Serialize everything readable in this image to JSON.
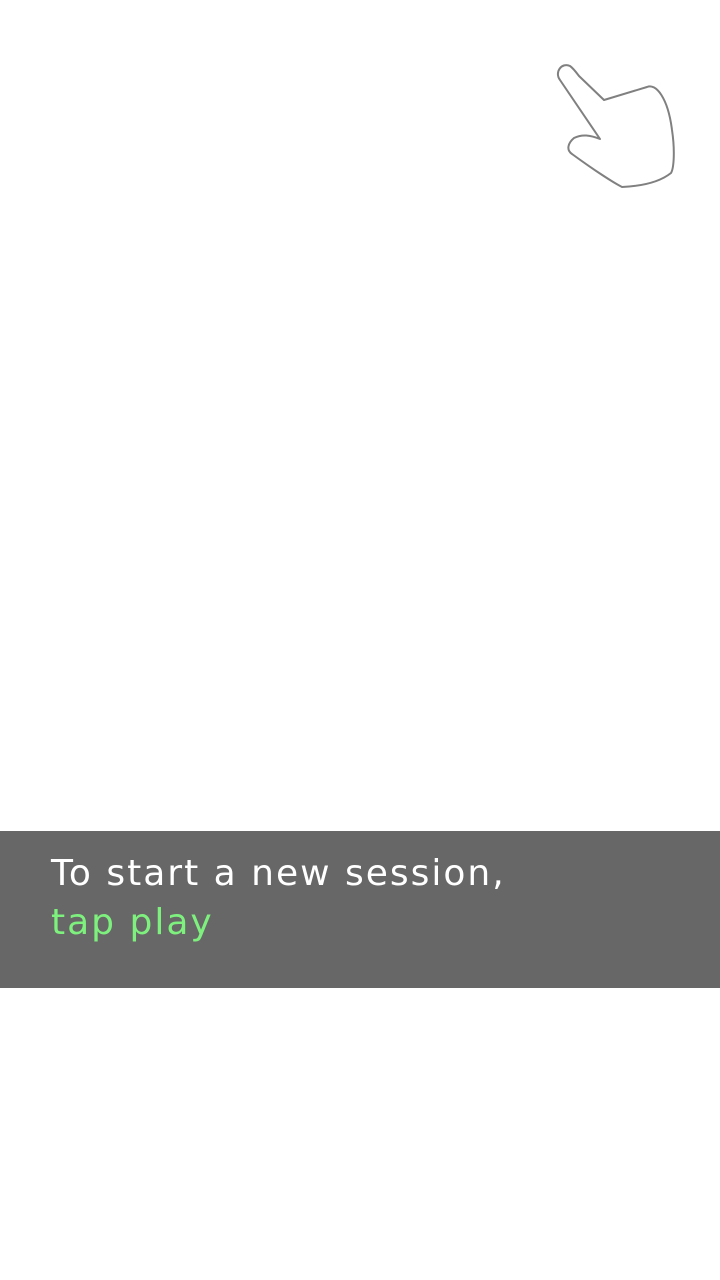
{
  "onboarding": {
    "pointer_icon": "hand-pointer-icon",
    "hint_text": "To start a new session,",
    "hint_action": "tap play"
  },
  "colors": {
    "background": "#ffffff",
    "banner": "#676767",
    "text": "#ffffff",
    "accent": "#7ef07e",
    "icon_stroke": "#808080"
  }
}
